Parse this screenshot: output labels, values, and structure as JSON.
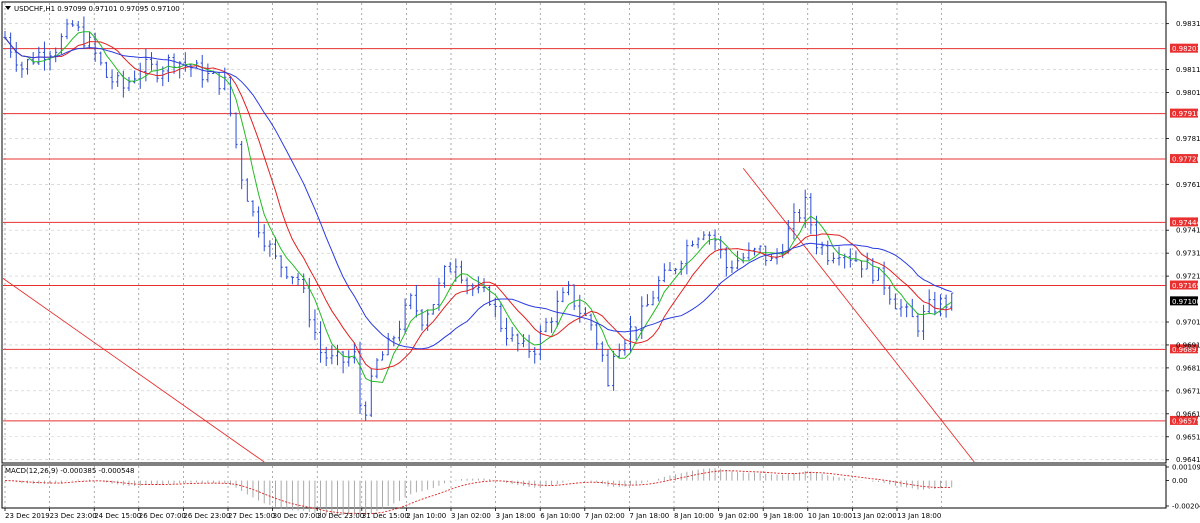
{
  "header": {
    "symbol_line": "USDCHF,H1  0.97099 0.97101 0.97095 0.97100",
    "macd_line": "MACD(12,26,9) -0.000385 -0.000548"
  },
  "colors": {
    "background": "#ffffff",
    "grid": "#c8c8c8",
    "candles": "#2a4bd7",
    "level_lines": "#e83030",
    "ma_fast": "#22bb22",
    "ma_mid": "#e02020",
    "ma_slow": "#2a3be0",
    "macd_hist": "#a0a0a0",
    "macd_signal": "#e02020",
    "current_price_box": "#000000"
  },
  "chart_data": {
    "type": "candlestick",
    "symbol": "USDCHF",
    "timeframe": "H1",
    "current_price": 0.971,
    "ylim": [
      0.964,
      0.984
    ],
    "y_ticks": [
      "0.98310",
      "0.98110",
      "0.98010",
      "0.97810",
      "0.97610",
      "0.97410",
      "0.97310",
      "0.97210",
      "0.97010",
      "0.96910",
      "0.96810",
      "0.96710",
      "0.96610",
      "0.96510",
      "0.96410"
    ],
    "y_tick_values": [
      0.9831,
      0.9811,
      0.9801,
      0.9781,
      0.9761,
      0.9741,
      0.9731,
      0.9721,
      0.9701,
      0.9691,
      0.9681,
      0.9671,
      0.9661,
      0.9651,
      0.9641
    ],
    "levels": [
      0.98201,
      0.97918,
      0.9772,
      0.97444,
      0.97169,
      0.96891,
      0.96579
    ],
    "level_labels": [
      "0.98201",
      "0.97918",
      "0.97720",
      "0.97444",
      "0.97169",
      "0.96891",
      "0.96579"
    ],
    "current_price_label": "0.97100",
    "x_labels": [
      "23 Dec 2019",
      "23 Dec 23:00",
      "24 Dec 15:00",
      "26 Dec 07:00",
      "26 Dec 23:00",
      "27 Dec 15:00",
      "30 Dec 07:00",
      "30 Dec 23:00",
      "31 Dec 15:00",
      "2 Jan 10:00",
      "3 Jan 02:00",
      "3 Jan 18:00",
      "6 Jan 10:00",
      "7 Jan 02:00",
      "7 Jan 18:00",
      "8 Jan 10:00",
      "9 Jan 02:00",
      "9 Jan 18:00",
      "10 Jan 10:00",
      "13 Jan 02:00",
      "13 Jan 18:00"
    ],
    "series_path": [
      [
        0,
        0.9825
      ],
      [
        3,
        0.9812
      ],
      [
        6,
        0.9818
      ],
      [
        9,
        0.9821
      ],
      [
        12,
        0.983
      ],
      [
        15,
        0.9822
      ],
      [
        18,
        0.9808
      ],
      [
        21,
        0.9803
      ],
      [
        24,
        0.9812
      ],
      [
        27,
        0.9811
      ],
      [
        30,
        0.9816
      ],
      [
        33,
        0.9812
      ],
      [
        36,
        0.9808
      ],
      [
        39,
        0.9805
      ],
      [
        40,
        0.9792
      ],
      [
        42,
        0.9765
      ],
      [
        44,
        0.9748
      ],
      [
        46,
        0.9738
      ],
      [
        48,
        0.9728
      ],
      [
        50,
        0.9724
      ],
      [
        52,
        0.972
      ],
      [
        54,
        0.9705
      ],
      [
        56,
        0.9688
      ],
      [
        58,
        0.9684
      ],
      [
        60,
        0.9684
      ],
      [
        62,
        0.9686
      ],
      [
        63,
        0.9665
      ],
      [
        64,
        0.9664
      ],
      [
        66,
        0.9683
      ],
      [
        68,
        0.969
      ],
      [
        70,
        0.97
      ],
      [
        72,
        0.971
      ],
      [
        74,
        0.9703
      ],
      [
        76,
        0.971
      ],
      [
        78,
        0.9722
      ],
      [
        80,
        0.9728
      ],
      [
        82,
        0.9718
      ],
      [
        84,
        0.9713
      ],
      [
        86,
        0.9712
      ],
      [
        88,
        0.97
      ],
      [
        90,
        0.9693
      ],
      [
        92,
        0.9689
      ],
      [
        94,
        0.969
      ],
      [
        96,
        0.97
      ],
      [
        98,
        0.9708
      ],
      [
        100,
        0.9714
      ],
      [
        102,
        0.9706
      ],
      [
        104,
        0.97
      ],
      [
        106,
        0.9686
      ],
      [
        107,
        0.9672
      ],
      [
        108,
        0.969
      ],
      [
        110,
        0.9695
      ],
      [
        112,
        0.97
      ],
      [
        114,
        0.9708
      ],
      [
        116,
        0.9718
      ],
      [
        118,
        0.9722
      ],
      [
        120,
        0.973
      ],
      [
        122,
        0.9738
      ],
      [
        124,
        0.9742
      ],
      [
        126,
        0.9737
      ],
      [
        128,
        0.9725
      ],
      [
        130,
        0.9728
      ],
      [
        132,
        0.973
      ],
      [
        134,
        0.9732
      ],
      [
        136,
        0.9727
      ],
      [
        138,
        0.9735
      ],
      [
        140,
        0.9745
      ],
      [
        142,
        0.9752
      ],
      [
        144,
        0.9736
      ],
      [
        146,
        0.9731
      ],
      [
        148,
        0.9733
      ],
      [
        150,
        0.973
      ],
      [
        152,
        0.9727
      ],
      [
        154,
        0.9723
      ],
      [
        156,
        0.9718
      ],
      [
        158,
        0.971
      ],
      [
        160,
        0.9704
      ],
      [
        162,
        0.97
      ],
      [
        164,
        0.9707
      ],
      [
        166,
        0.9709
      ],
      [
        168,
        0.971
      ]
    ],
    "indicator": {
      "name": "MACD(12,26,9)",
      "main": -0.000385,
      "signal": -0.000548,
      "ylim": [
        -0.002044,
        0.001092
      ],
      "y_ticks": [
        "0.001092",
        "0.00",
        "-0.002044"
      ],
      "y_tick_values": [
        0.001092,
        0.0,
        -0.002044
      ]
    },
    "grid": true
  }
}
